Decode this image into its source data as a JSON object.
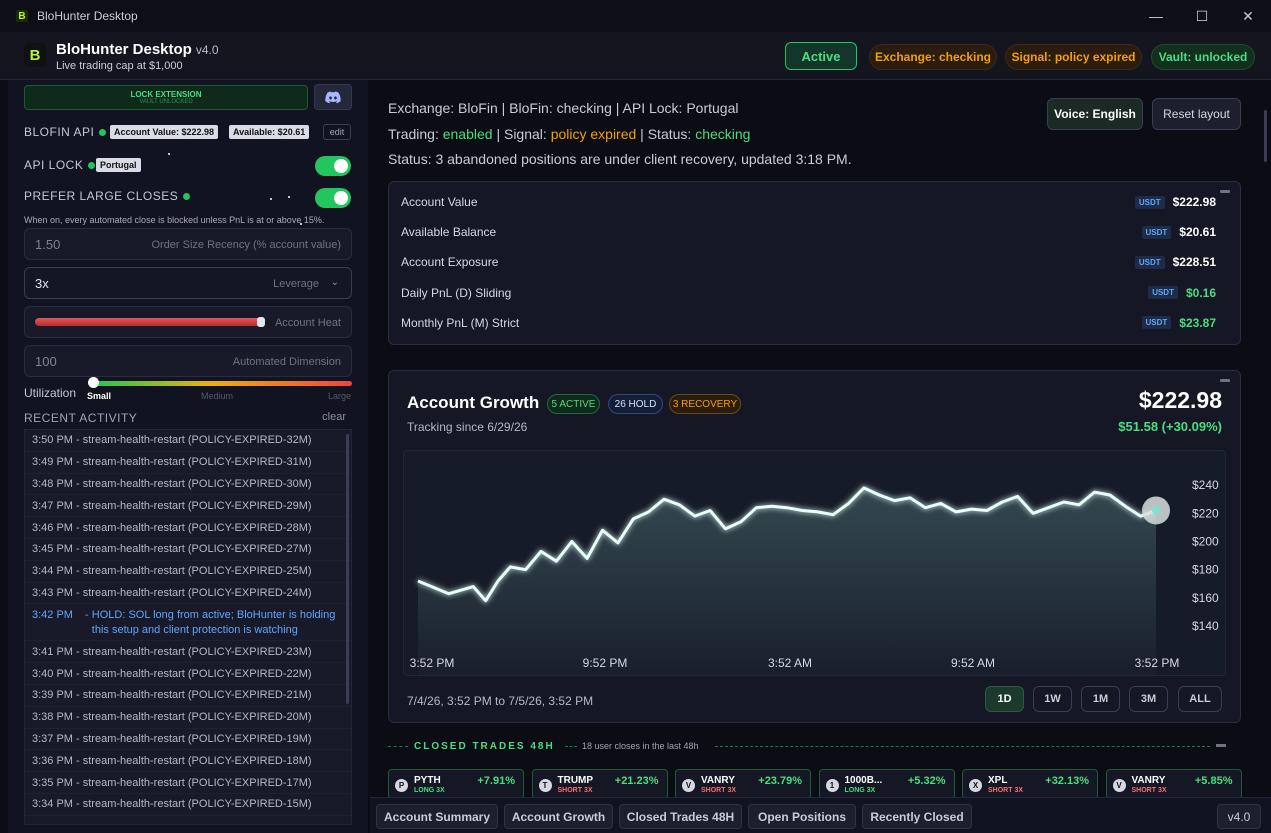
{
  "window": {
    "title": "BloHunter Desktop",
    "minimize": "—",
    "maximize": "☐",
    "close": "✕"
  },
  "header": {
    "logo_letter": "B",
    "app_name": "BloHunter Desktop",
    "version": "v4.0",
    "subtitle": "Live trading cap at $1,000",
    "status_active": "Active",
    "exchange_status": "Exchange: checking",
    "signal_status": "Signal: policy expired",
    "vault_status": "Vault: unlocked"
  },
  "sidebar": {
    "lock_extension": {
      "label": "LOCK EXTENSION",
      "sublabel": "VAULT UNLOCKED"
    },
    "blofin_api": {
      "label": "BLOFIN API",
      "account_value": "Account Value: $222.98",
      "available": "Available: $20.61",
      "edit": "edit"
    },
    "api_lock": {
      "label": "API LOCK",
      "value": "Portugal",
      "enabled": true
    },
    "prefer_large_closes": {
      "label": "PREFER LARGE CLOSES",
      "enabled": true,
      "hint": "When on, every automated close is blocked unless PnL is at or above 15%."
    },
    "order_size": {
      "value": "1.50",
      "placeholder": "Order Size Recency (% account value)"
    },
    "leverage": {
      "value": "3x",
      "placeholder": "Leverage"
    },
    "account_heat": {
      "placeholder": "Account Heat",
      "level": 0.7
    },
    "automated_dimension": {
      "value": "100",
      "placeholder": "Automated Dimension"
    },
    "utilization": {
      "label": "Utilization",
      "ticks": [
        "Small",
        "Medium",
        "Large"
      ],
      "selected": "Small"
    },
    "recent_activity": {
      "title": "RECENT ACTIVITY",
      "clear": "clear",
      "items": [
        {
          "time": "3:50 PM",
          "text": "stream-health-restart (POLICY-EXPIRED-32M)"
        },
        {
          "time": "3:49 PM",
          "text": "stream-health-restart (POLICY-EXPIRED-31M)"
        },
        {
          "time": "3:48 PM",
          "text": "stream-health-restart (POLICY-EXPIRED-30M)"
        },
        {
          "time": "3:47 PM",
          "text": "stream-health-restart (POLICY-EXPIRED-29M)"
        },
        {
          "time": "3:46 PM",
          "text": "stream-health-restart (POLICY-EXPIRED-28M)"
        },
        {
          "time": "3:45 PM",
          "text": "stream-health-restart (POLICY-EXPIRED-27M)"
        },
        {
          "time": "3:44 PM",
          "text": "stream-health-restart (POLICY-EXPIRED-25M)"
        },
        {
          "time": "3:43 PM",
          "text": "stream-health-restart (POLICY-EXPIRED-24M)"
        },
        {
          "time": "3:42 PM",
          "text": "HOLD: SOL long from active; BloHunter is holding this setup and client protection is watching",
          "highlight": true
        },
        {
          "time": "3:41 PM",
          "text": "stream-health-restart (POLICY-EXPIRED-23M)"
        },
        {
          "time": "3:40 PM",
          "text": "stream-health-restart (POLICY-EXPIRED-22M)"
        },
        {
          "time": "3:39 PM",
          "text": "stream-health-restart (POLICY-EXPIRED-21M)"
        },
        {
          "time": "3:38 PM",
          "text": "stream-health-restart (POLICY-EXPIRED-20M)"
        },
        {
          "time": "3:37 PM",
          "text": "stream-health-restart (POLICY-EXPIRED-19M)"
        },
        {
          "time": "3:36 PM",
          "text": "stream-health-restart (POLICY-EXPIRED-18M)"
        },
        {
          "time": "3:35 PM",
          "text": "stream-health-restart (POLICY-EXPIRED-17M)"
        },
        {
          "time": "3:34 PM",
          "text": "stream-health-restart (POLICY-EXPIRED-15M)"
        }
      ]
    }
  },
  "main": {
    "info1": {
      "exchange": "Exchange: BloFin",
      "blofin": "BloFin: checking",
      "api_lock": "API Lock: Portugal"
    },
    "info2": {
      "trading_label": "Trading:",
      "trading_value": "enabled",
      "signal_label": "Signal:",
      "signal_value": "policy expired",
      "status_label": "Status:",
      "status_value": "checking"
    },
    "info3": "Status: 3 abandoned positions are under client recovery, updated 3:18 PM.",
    "voice_button": "Voice: English",
    "reset_button": "Reset layout",
    "account_summary": {
      "currency": "USDT",
      "rows": [
        {
          "label": "Account Value",
          "value": "$222.98",
          "positive": false
        },
        {
          "label": "Available Balance",
          "value": "$20.61",
          "positive": false
        },
        {
          "label": "Account Exposure",
          "value": "$228.51",
          "positive": false
        },
        {
          "label": "Daily PnL (D) Sliding",
          "value": "$0.16",
          "positive": true
        },
        {
          "label": "Monthly PnL (M) Strict",
          "value": "$23.87",
          "positive": true
        }
      ]
    },
    "account_growth": {
      "title": "Account Growth",
      "tags": {
        "active": "5 ACTIVE",
        "hold": "26 HOLD",
        "recovery": "3 RECOVERY"
      },
      "tracking": "Tracking since 6/29/26",
      "value": "$222.98",
      "change": "$51.58 (+30.09%)",
      "range_label": "7/4/26, 3:52 PM to 7/5/26, 3:52 PM",
      "ranges": [
        "1D",
        "1W",
        "1M",
        "3M",
        "ALL"
      ],
      "selected_range": "1D"
    },
    "closed_trades": {
      "title": "CLOSED TRADES 48H",
      "subtitle": "18 user closes in the last 48h",
      "trades": [
        {
          "badge": "P",
          "symbol": "PYTH",
          "side": "LONG 3X",
          "dir": "long",
          "pct": "+7.91%"
        },
        {
          "badge": "T",
          "symbol": "TRUMP",
          "side": "SHORT 3X",
          "dir": "short",
          "pct": "+21.23%"
        },
        {
          "badge": "V",
          "symbol": "VANRY",
          "side": "SHORT 3X",
          "dir": "short",
          "pct": "+23.79%"
        },
        {
          "badge": "1",
          "symbol": "1000B...",
          "side": "LONG 3X",
          "dir": "long",
          "pct": "+5.32%"
        },
        {
          "badge": "X",
          "symbol": "XPL",
          "side": "SHORT 3X",
          "dir": "short",
          "pct": "+32.13%"
        },
        {
          "badge": "V",
          "symbol": "VANRY",
          "side": "SHORT 3X",
          "dir": "short",
          "pct": "+5.85%"
        }
      ]
    }
  },
  "bottom_bar": {
    "buttons": [
      "Account Summary",
      "Account Growth",
      "Closed Trades 48H",
      "Open Positions",
      "Recently Closed"
    ],
    "version": "v4.0"
  },
  "chart_data": {
    "type": "line",
    "title": "Account Growth",
    "x_ticks": [
      "3:52 PM",
      "9:52 PM",
      "3:52 AM",
      "9:52 AM",
      "3:52 PM"
    ],
    "y_ticks": [
      "$240",
      "$220",
      "$200",
      "$180",
      "$160",
      "$140"
    ],
    "ylim": [
      128,
      250
    ],
    "grid": false,
    "series": [
      {
        "x": [
          0,
          1,
          1.8,
          2.2,
          2.6,
          3,
          3.5,
          4,
          4.5,
          5,
          5.5,
          6,
          6.5,
          7,
          7.5,
          8,
          8.5,
          9,
          9.5,
          10,
          10.5,
          11,
          11.5,
          12,
          12.5,
          13,
          13.5,
          14,
          14.5,
          15,
          15.5,
          16,
          16.5,
          17,
          17.5,
          18,
          18.5,
          19,
          19.5,
          20,
          20.5,
          21,
          21.5,
          22,
          22.5,
          23,
          23.5,
          24
        ],
        "values": [
          172,
          163,
          168,
          158,
          172,
          182,
          180,
          193,
          186,
          200,
          188,
          208,
          199,
          216,
          221,
          230,
          226,
          218,
          222,
          209,
          214,
          224,
          225,
          224,
          222,
          221,
          219,
          227,
          238,
          233,
          229,
          231,
          224,
          227,
          221,
          223,
          222,
          228,
          232,
          220,
          224,
          228,
          226,
          235,
          233,
          225,
          218,
          222
        ]
      }
    ]
  }
}
